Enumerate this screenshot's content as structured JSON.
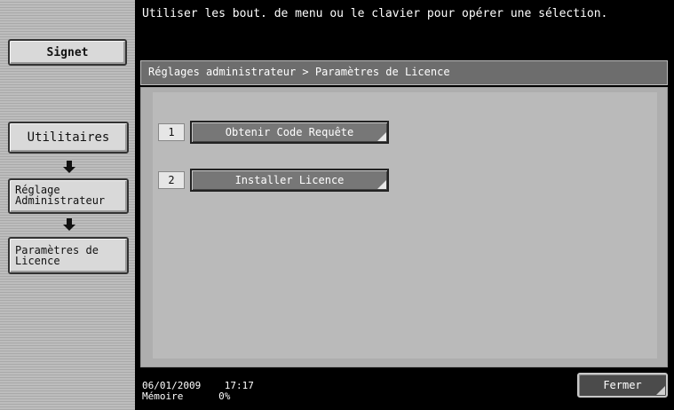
{
  "message": "Utiliser les bout. de menu ou le clavier pour opérer une sélection.",
  "sidebar": {
    "bookmark_label": "Signet",
    "items": [
      {
        "label": "Utilitaires"
      },
      {
        "label": "Réglage\nAdministrateur"
      },
      {
        "label": "Paramètres de\nLicence"
      }
    ]
  },
  "breadcrumb": "Réglages administrateur  > Paramètres de Licence",
  "options": [
    {
      "number": "1",
      "label": "Obtenir Code Requête"
    },
    {
      "number": "2",
      "label": "Installer Licence"
    }
  ],
  "status": {
    "date": "06/01/2009",
    "time": "17:17",
    "memory_label": "Mémoire",
    "memory_value": "0%"
  },
  "close_label": "Fermer"
}
